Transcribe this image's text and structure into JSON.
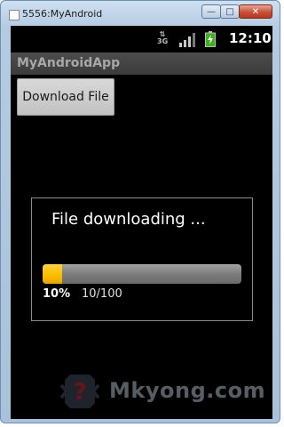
{
  "window": {
    "title": "5556:MyAndroid",
    "minimize_label": "—",
    "maximize_label": "□",
    "close_label": "✕"
  },
  "statusbar": {
    "network": "3G",
    "time": "12:10"
  },
  "app": {
    "title": "MyAndroidApp",
    "download_button": "Download File"
  },
  "dialog": {
    "title": "File downloading ...",
    "progress_fraction": 0.1,
    "percent_text": "10%",
    "count_text": "10/100"
  },
  "watermark": {
    "text": "Mkyong.com",
    "logo_glyph": "?"
  },
  "colors": {
    "progress_fill": "#ffbf00",
    "screen_background": "#000000"
  }
}
